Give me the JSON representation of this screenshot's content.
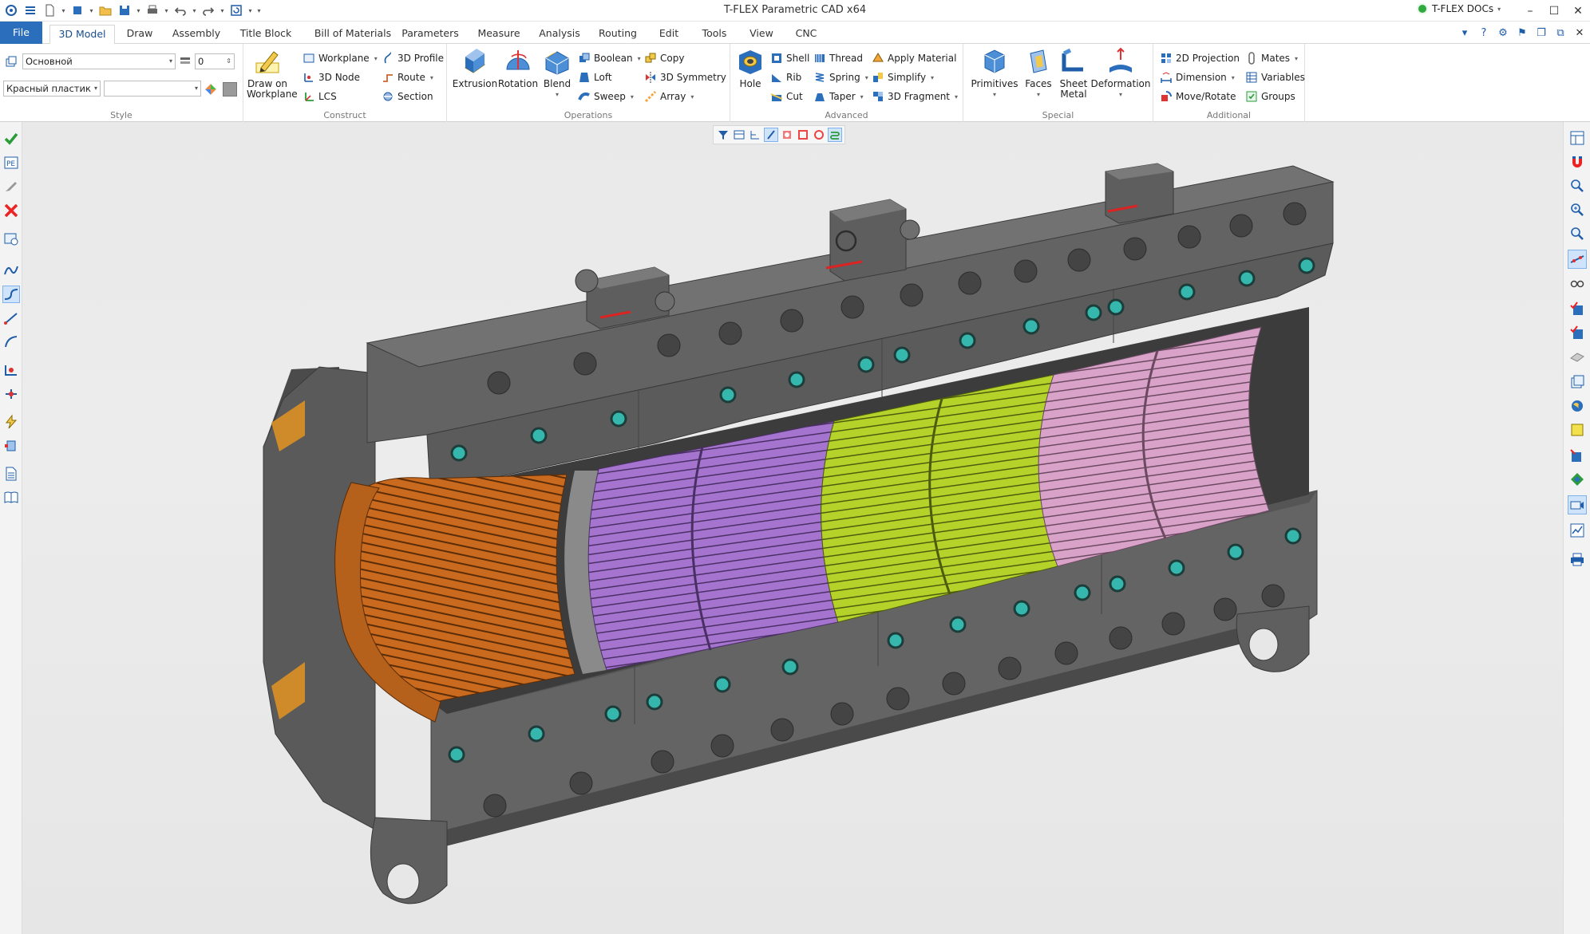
{
  "window": {
    "title": "T-FLEX Parametric CAD x64",
    "docs_label": "T-FLEX DOCs",
    "controls": [
      "–",
      "☐",
      "✕"
    ]
  },
  "tabs": [
    {
      "label": "File",
      "active": false
    },
    {
      "label": "3D Model",
      "active": true
    },
    {
      "label": "Draw",
      "active": false
    },
    {
      "label": "Assembly",
      "active": false
    },
    {
      "label": "Title Block",
      "active": false
    },
    {
      "label": "Bill of Materials",
      "active": false
    },
    {
      "label": "Parameters",
      "active": false
    },
    {
      "label": "Measure",
      "active": false
    },
    {
      "label": "Analysis",
      "active": false
    },
    {
      "label": "Routing",
      "active": false
    },
    {
      "label": "Edit",
      "active": false
    },
    {
      "label": "Tools",
      "active": false
    },
    {
      "label": "View",
      "active": false
    },
    {
      "label": "CNC",
      "active": false
    }
  ],
  "ribbon": {
    "style": {
      "label": "Style",
      "layer_value": "Основной",
      "level_value": "0",
      "material_value": "Красный пластик",
      "color_value": ""
    },
    "construct": {
      "label": "Construct",
      "draw_on_workplane": "Draw on Workplane",
      "workplane": "Workplane",
      "node": "3D Node",
      "lcs": "LCS",
      "profile": "3D Profile",
      "route": "Route",
      "section": "Section"
    },
    "operations": {
      "label": "Operations",
      "extrusion": "Extrusion",
      "rotation": "Rotation",
      "blend": "Blend",
      "boolean": "Boolean",
      "loft": "Loft",
      "sweep": "Sweep",
      "copy": "Copy",
      "symmetry": "3D Symmetry",
      "array": "Array"
    },
    "advanced": {
      "label": "Advanced",
      "hole": "Hole",
      "shell": "Shell",
      "rib": "Rib",
      "cut": "Cut",
      "thread": "Thread",
      "spring": "Spring",
      "taper": "Taper",
      "apply_material": "Apply Material",
      "simplify": "Simplify",
      "fragment": "3D Fragment"
    },
    "special": {
      "label": "Special",
      "primitives": "Primitives",
      "faces": "Faces",
      "sheet_metal_1": "Sheet",
      "sheet_metal_2": "Metal",
      "deformation": "Deformation"
    },
    "additional": {
      "label": "Additional",
      "projection": "2D Projection",
      "dimension": "Dimension",
      "move_rotate": "Move/Rotate",
      "mates": "Mates",
      "variables": "Variables",
      "groups": "Groups"
    }
  },
  "colors": {
    "accent": "#2a6ebc",
    "housing": "#5f5f5f",
    "housing_light": "#727272",
    "housing_dark": "#444444",
    "orange": "#c96a1e",
    "purple": "#a574cf",
    "green": "#b5d22b",
    "pink": "#d9a2c9",
    "teal": "#35b7ad"
  },
  "icons": {
    "left_toolbar": [
      "check-icon",
      "properties-icon",
      "scalpel-icon",
      "cancel-icon",
      "view-icon",
      "curve-icon",
      "spline-icon",
      "line-icon",
      "arc-icon",
      "node-icon",
      "node-edge-icon",
      "lightning-icon",
      "cylinder-icon",
      "document-icon",
      "book-icon"
    ],
    "right_toolbar": [
      "window-icon",
      "magnet-icon",
      "zoom-icon",
      "zoom-window-icon",
      "zoom-fit-icon",
      "snap-icon",
      "glasses-icon",
      "cube-check-icon",
      "cube-check2-icon",
      "plane-icon",
      "layers-icon",
      "globe-icon",
      "cube-yellow-icon",
      "cube-blue-icon",
      "cube-green-icon",
      "camera-icon",
      "chart-icon",
      "printer-icon"
    ]
  }
}
